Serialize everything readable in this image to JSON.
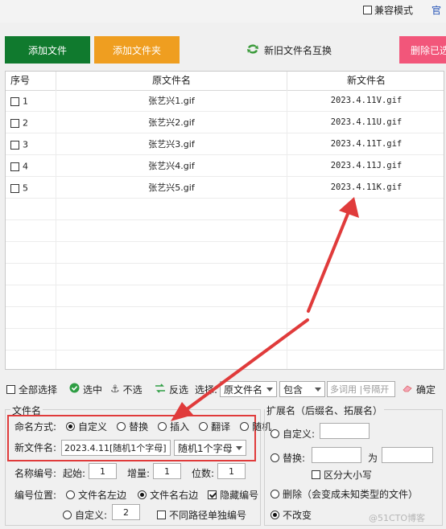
{
  "top": {
    "compat_label": "兼容模式",
    "compat_checked": false,
    "corner_link": "官"
  },
  "toolbar": {
    "add_file": "添加文件",
    "add_folder": "添加文件夹",
    "swap_names": "新旧文件名互换",
    "delete_selected": "删除已选"
  },
  "table": {
    "headers": [
      "序号",
      "原文件名",
      "新文件名"
    ],
    "rows": [
      {
        "num": "1",
        "old": "张艺兴1.gif",
        "new": "2023.4.11V.gif"
      },
      {
        "num": "2",
        "old": "张艺兴2.gif",
        "new": "2023.4.11U.gif"
      },
      {
        "num": "3",
        "old": "张艺兴3.gif",
        "new": "2023.4.11T.gif"
      },
      {
        "num": "4",
        "old": "张艺兴4.gif",
        "new": "2023.4.11J.gif"
      },
      {
        "num": "5",
        "old": "张艺兴5.gif",
        "new": "2023.4.11K.gif"
      }
    ]
  },
  "filter": {
    "select_all": "全部选择",
    "select": "选中",
    "deselect": "不选",
    "invert": "反选",
    "select_label": "选择:",
    "field_value": "原文件名",
    "match_value": "包含",
    "keywords_placeholder": "多词用 |号隔开",
    "confirm": "确定"
  },
  "filename_panel": {
    "title": "文件名",
    "naming_label": "命名方式:",
    "modes": [
      "自定义",
      "替换",
      "插入",
      "翻译",
      "随机"
    ],
    "selected_mode": "自定义",
    "new_name_label": "新文件名:",
    "new_name_value": "2023.4.11[随机1个字母]",
    "insert_select": "随机1个字母",
    "numbering_label": "名称编号:",
    "start_label": "起始:",
    "start_value": "1",
    "step_label": "增量:",
    "step_value": "1",
    "digits_label": "位数:",
    "digits_value": "1",
    "position_label": "编号位置:",
    "pos_left": "文件名左边",
    "pos_right": "文件名右边",
    "hide_number": "隐藏编号",
    "custom_label": "自定义:",
    "custom_value": "2",
    "per_path": "不同路径单独编号"
  },
  "ext_panel": {
    "title": "扩展名（后缀名、拓展名）",
    "custom": "自定义:",
    "replace": "替换:",
    "replace_to": "为",
    "case_sensitive": "区分大小写",
    "delete": "删除（会变成未知类型的文件）",
    "no_change": "不改变"
  },
  "watermark": "@51CTO博客",
  "colors": {
    "add_file": "#107a2e",
    "add_folder": "#ef9e20",
    "delete": "#f2567a",
    "annotation": "#e03b3b"
  }
}
